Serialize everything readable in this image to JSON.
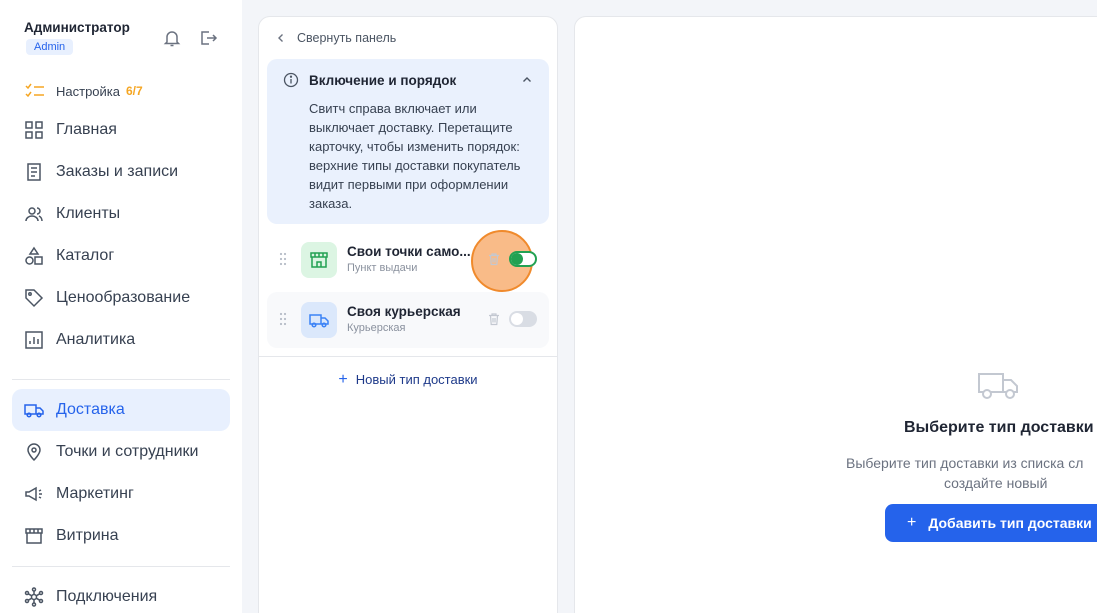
{
  "user": {
    "name": "Администратор",
    "role": "Admin"
  },
  "setup": {
    "label": "Настройка",
    "count": "6/7"
  },
  "nav": {
    "home": "Главная",
    "orders": "Заказы и записи",
    "clients": "Клиенты",
    "catalog": "Каталог",
    "pricing": "Ценообразование",
    "analytics": "Аналитика",
    "delivery": "Доставка",
    "points": "Точки и сотрудники",
    "marketing": "Маркетинг",
    "storefront": "Витрина",
    "integrations": "Подключения"
  },
  "panel": {
    "collapse_label": "Свернуть панель",
    "info_title": "Включение и порядок",
    "info_text": "Свитч справа включает или выключает доставку. Перетащите карточку, чтобы изменить порядок: верхние типы доставки покупатель видит первыми при оформлении заказа.",
    "deliveries": [
      {
        "title": "Свои точки само...",
        "subtitle": "Пункт выдачи",
        "enabled": true,
        "icon": "store-icon"
      },
      {
        "title": "Своя курьерская",
        "subtitle": "Курьерская",
        "enabled": false,
        "icon": "truck-icon"
      }
    ],
    "add_label": "Новый тип доставки"
  },
  "detail": {
    "empty_title": "Выберите тип доставки",
    "empty_text_line1": "Выберите тип доставки из списка сл",
    "empty_text_line2": "создайте новый",
    "add_button": "Добавить тип доставки"
  },
  "colors": {
    "accent": "#2563eb",
    "success": "#22a152",
    "warning": "#f5a623"
  }
}
